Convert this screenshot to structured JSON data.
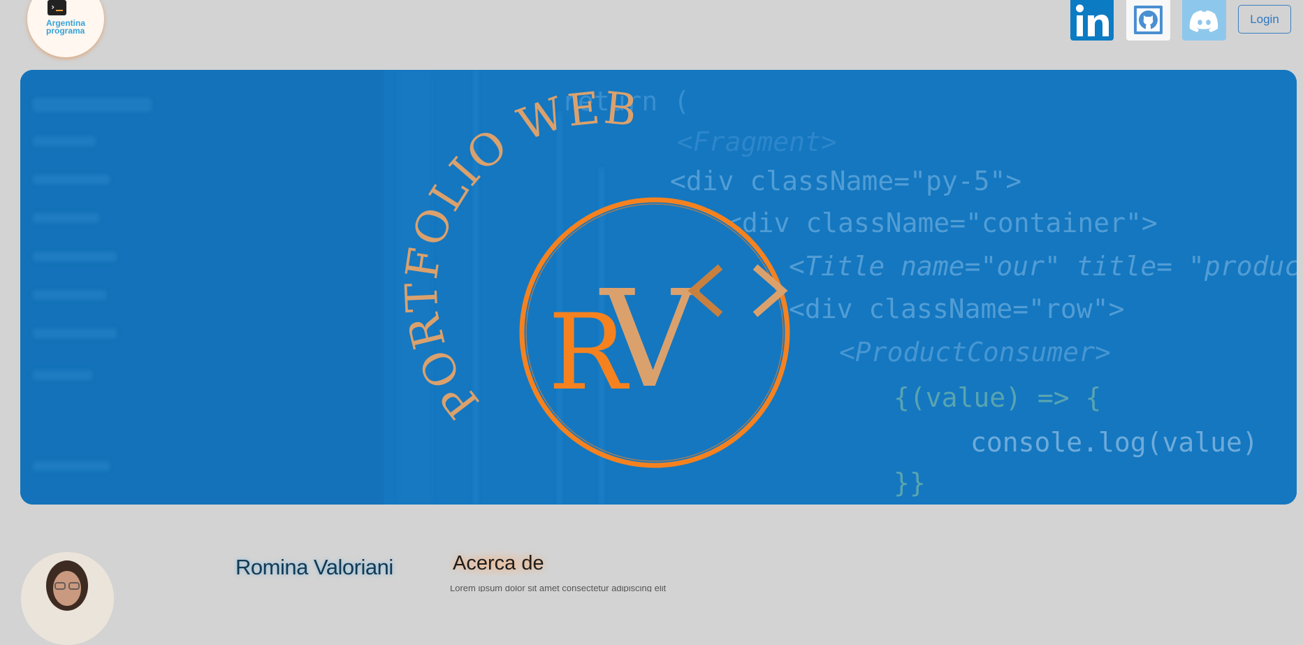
{
  "header": {
    "logo_line1": "Argentina",
    "logo_line2": "programa",
    "logo_terminal_prompt": "›",
    "social_icons": [
      "linkedin-icon",
      "github-icon",
      "discord-icon"
    ],
    "login_label": "Login"
  },
  "hero": {
    "arc_text": "PORTFOLIO WEB",
    "monogram_r": "R",
    "monogram_v": "V",
    "code_lines": [
      "return (",
      "<Fragment>",
      "<div className=\"py-5\">",
      "<div className=\"container\">",
      "<Title name=\"our\" title= \"product",
      "<div className=\"row\">",
      "<ProductConsumer>",
      "{(value) => {",
      "console.log(value)",
      "}}"
    ]
  },
  "profile": {
    "name": "Romina Valoriani",
    "about_heading": "Acerca de",
    "about_partial_text": "Lorem ipsum dolor sit amet consectetur adipiscing elit"
  },
  "colors": {
    "page_bg": "#d3d3d3",
    "hero_bg": "#1477c0",
    "accent_orange": "#f5821f",
    "logo_beige": "#dba16d",
    "linkedin_blue": "#0b7bc3",
    "discord_light": "#8ec7ec"
  }
}
